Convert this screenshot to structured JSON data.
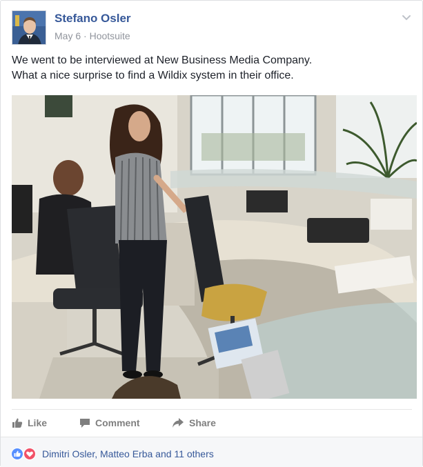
{
  "post": {
    "author": "Stefano Osler",
    "date": "May 6",
    "separator": "·",
    "source": "Hootsuite",
    "text_line1": "We went to be interviewed at New Business Media Company.",
    "text_line2": "What a nice surprise to find a Wildix system in their office."
  },
  "actions": {
    "like_label": "Like",
    "comment_label": "Comment",
    "share_label": "Share"
  },
  "reactions": {
    "summary": "Dimitri Osler, Matteo Erba and 11 others",
    "types": [
      "like-icon",
      "love-icon"
    ]
  },
  "icons": {
    "options": "chevron-down-icon",
    "like": "thumbs-up-icon",
    "comment": "speech-bubble-icon",
    "share": "share-arrow-icon"
  },
  "colors": {
    "link": "#365899",
    "muted": "#90949c",
    "like_blue": "#5890ff",
    "love_red": "#f25268"
  }
}
